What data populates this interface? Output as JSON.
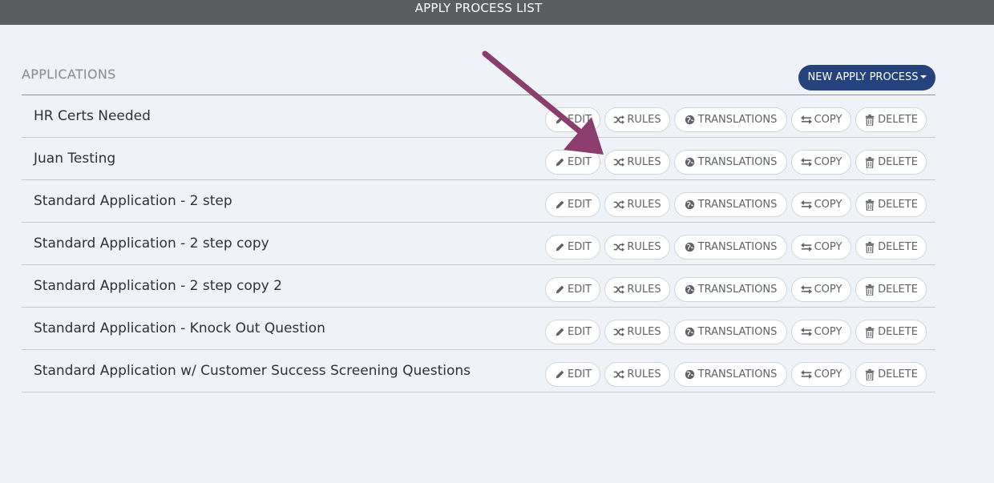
{
  "header": {
    "title": "APPLY PROCESS LIST"
  },
  "section": {
    "heading": "APPLICATIONS"
  },
  "new_button": {
    "label": "NEW APPLY PROCESS"
  },
  "row_actions": {
    "edit": "EDIT",
    "rules": "RULES",
    "translations": "TRANSLATIONS",
    "copy": "COPY",
    "delete": "DELETE"
  },
  "applications": [
    {
      "name": "HR Certs Needed"
    },
    {
      "name": "Juan Testing"
    },
    {
      "name": "Standard Application - 2 step"
    },
    {
      "name": "Standard Application - 2 step copy"
    },
    {
      "name": "Standard Application - 2 step copy 2"
    },
    {
      "name": "Standard Application - Knock Out Question"
    },
    {
      "name": "Standard Application w/ Customer Success Screening Questions"
    }
  ],
  "colors": {
    "header_bg": "#5c5d60",
    "page_bg": "#eff2f6",
    "primary_button": "#24427b",
    "annotation_arrow": "#8b3d6e"
  },
  "icons": {
    "edit": "pencil-icon",
    "rules": "shuffle-icon",
    "translations": "globe-icon",
    "copy": "swap-arrows-icon",
    "delete": "trash-icon"
  }
}
